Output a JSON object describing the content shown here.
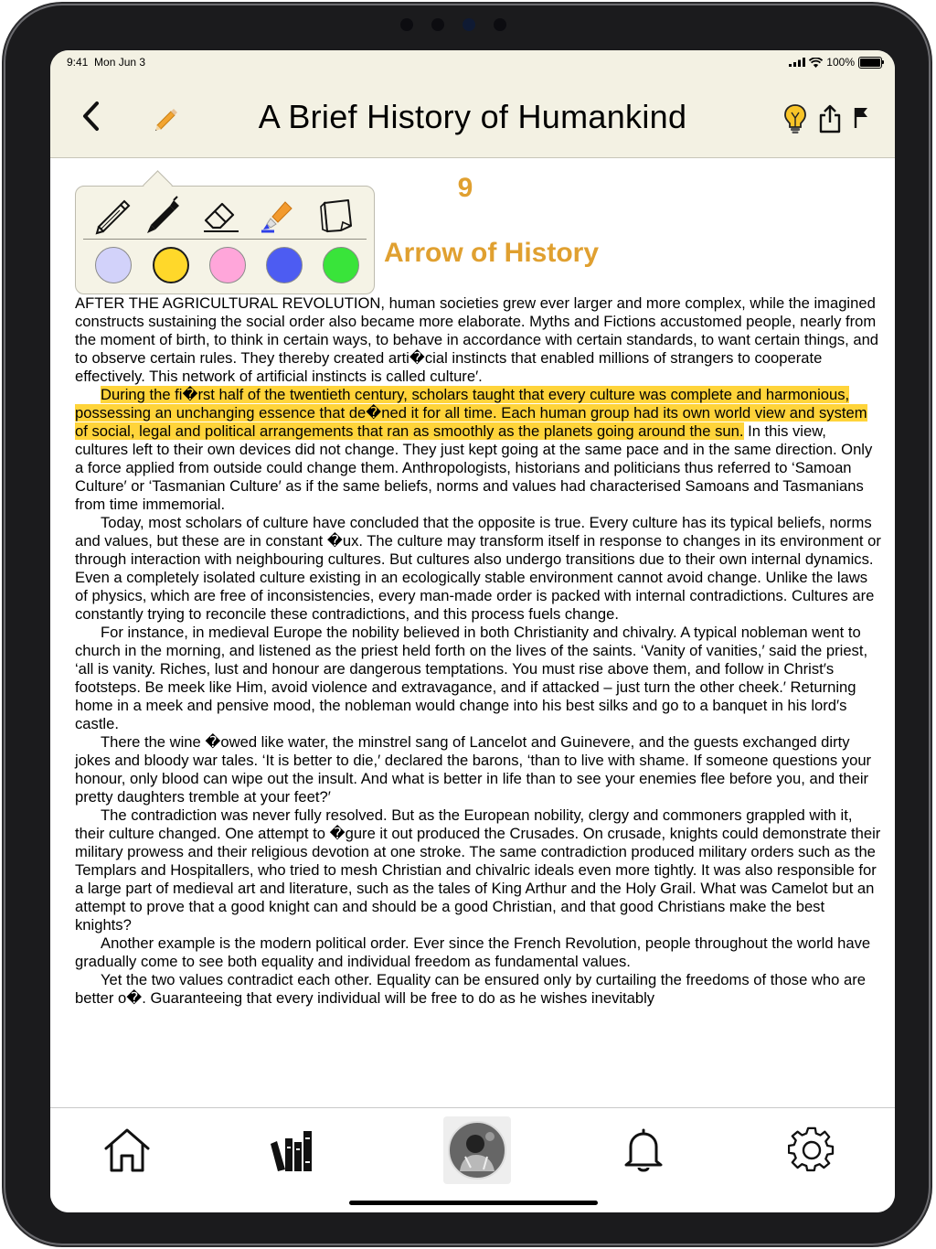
{
  "status_bar": {
    "time": "9:41",
    "date": "Mon Jun 3",
    "battery": "100%"
  },
  "header": {
    "title": "A Brief History of Humankind"
  },
  "icons": {
    "back": "chevron-left-icon",
    "edit": "pencil-icon",
    "tips": "lightbulb-icon",
    "share": "share-icon",
    "bookmark": "flag-icon"
  },
  "annotation_popover": {
    "tools": [
      "pencil",
      "pen",
      "eraser",
      "highlighter",
      "sticky-note"
    ],
    "colors": [
      {
        "name": "lavender",
        "hex": "#d2d2fa"
      },
      {
        "name": "yellow",
        "hex": "#ffd82a",
        "selected": true
      },
      {
        "name": "pink",
        "hex": "#ffa6da"
      },
      {
        "name": "blue",
        "hex": "#4d5cf2"
      },
      {
        "name": "green",
        "hex": "#39e43a"
      }
    ]
  },
  "chapter": {
    "number": "9",
    "title": "Arrow of History"
  },
  "article": {
    "p1_lead": "AFTER THE AGRICULTURAL REVOLUTION",
    "p1_rest": ", human societies grew ever larger and more complex, while the imagined constructs sustaining the social order also became more elaborate. Myths and Fictions accustomed people, nearly from the moment of birth, to think in certain ways, to behave in accordance with certain standards, to want certain things, and to observe certain rules. They thereby created arti�cial instincts that enabled millions of strangers to cooperate effectively. This network of artificial instincts is called culture′.",
    "p2_highlight": "During the fi�rst half of the twentieth century, scholars taught that every culture was complete and harmonious, possessing an unchanging essence that de�ned it for all time. Each human group had its own world view and system of social, legal and political arrangements that ran as smoothly as the planets going around the sun.",
    "p2_rest": " In this view, cultures left to their own devices did not change. They just kept going at the same pace and in the same direction. Only a force applied from outside could change them. Anthropologists, historians and politicians thus referred to ‘Samoan Culture′ or ‘Tasmanian Culture′ as if the same beliefs, norms and values had characterised Samoans and Tasmanians from time immemorial.",
    "p3": "Today, most scholars of culture have concluded that the opposite is true. Every culture has its typical beliefs, norms and values, but these are in constant �ux. The culture may transform itself in response to changes in its environment or through interaction with neighbouring cultures. But cultures also undergo transitions due to their own internal dynamics. Even a completely isolated culture existing in an ecologically stable environment cannot avoid change. Unlike the laws of physics, which are free of inconsistencies, every man-made order is packed with internal contradictions. Cultures are constantly trying to reconcile these contradictions, and this process fuels change.",
    "p4": "For instance, in medieval Europe the nobility believed in both Christianity and chivalry. A typical nobleman went to church in the morning, and listened as the priest held forth on the lives of the saints. ‘Vanity of vanities,′ said the priest, ‘all is vanity. Riches, lust and honour are dangerous temptations. You must rise above them, and follow in Christ′s footsteps. Be meek like Him, avoid violence and extravagance, and if attacked – just turn the other cheek.′ Returning home in a meek and pensive mood, the nobleman would change into his best silks and go to a banquet in his lord′s castle.",
    "p5": "There the wine �owed like water, the minstrel sang of Lancelot and Guinevere, and the guests exchanged dirty jokes and bloody war tales. ‘It is better to die,′ declared the barons, ‘than to live with shame. If someone questions your honour, only blood can wipe out the insult. And what is better in life than to see your enemies flee before you, and their pretty daughters tremble at your feet?′",
    "p6": "The contradiction was never fully resolved. But as the European nobility, clergy and commoners grappled with it, their culture changed. One attempt to �gure it out produced the Crusades. On crusade, knights could demonstrate their military prowess and their religious devotion at one stroke. The same contradiction produced military orders such as the Templars and Hospitallers, who tried to mesh Christian and chivalric ideals even more tightly. It was also responsible for a large part of medieval art and literature, such as the tales of King Arthur and the Holy Grail. What was Camelot but an attempt to prove that a good knight can and should be a good Christian, and that good Christians make the best knights?",
    "p7": "Another example is the modern political order. Ever since the French Revolution, people throughout the world have gradually come to see both equality and individual freedom as fundamental values.",
    "p8": "Yet the two values contradict each other. Equality can be ensured only by curtailing the freedoms of those who are better o�. Guaranteeing that every individual will be free to do as he wishes inevitably"
  },
  "tab_bar": {
    "items": [
      "home-icon",
      "library-icon",
      "profile-avatar",
      "bell-icon",
      "gear-icon"
    ]
  }
}
